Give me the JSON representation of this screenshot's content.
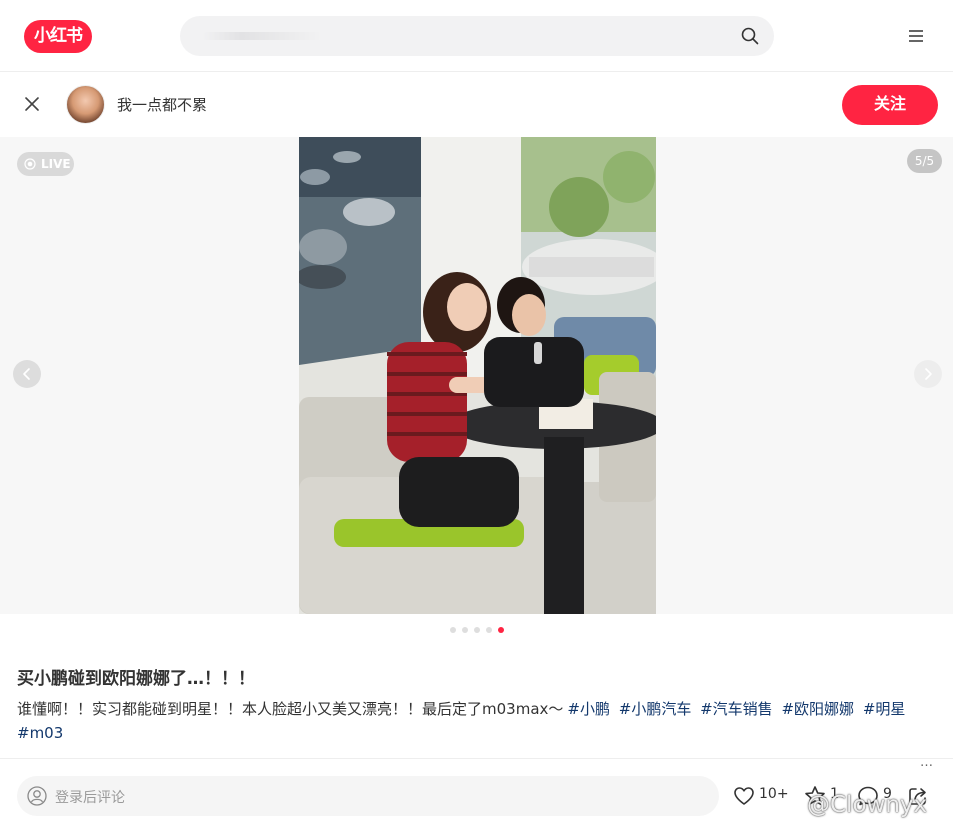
{
  "header": {
    "logo_text": "小红书",
    "search_placeholder": "",
    "brand_color": "#ff2442"
  },
  "author": {
    "name": "我一点都不累",
    "follow_label": "关注"
  },
  "media": {
    "live_label": "LIVE",
    "counter": "5/5",
    "total_slides": 5,
    "current_slide": 5
  },
  "note": {
    "title": "买小鹏碰到欧阳娜娜了…！！！",
    "description": "谁懂啊！！实习都能碰到明星！！本人脸超小又美又漂亮！！最后定了m03max～",
    "tags": [
      "#小鹏",
      "#小鹏汽车",
      "#汽车销售",
      "#欧阳娜娜",
      "#明星",
      "#m03"
    ],
    "more_label": "…"
  },
  "footer": {
    "comment_placeholder": "登录后评论",
    "like_count": "10+",
    "collect_count": "1",
    "comment_count": "9",
    "watermark": "@Clownyx"
  }
}
